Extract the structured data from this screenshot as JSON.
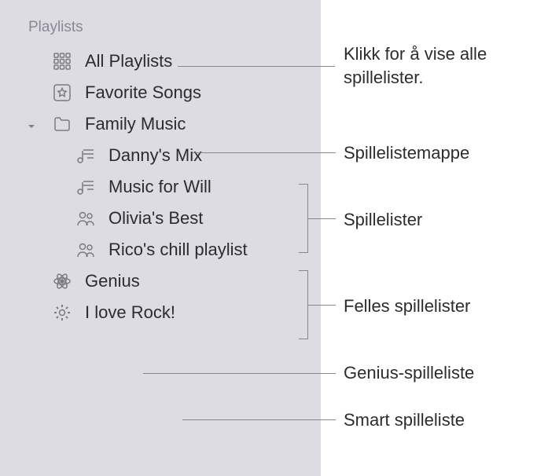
{
  "sidebar": {
    "section_header": "Playlists",
    "items": [
      {
        "label": "All Playlists"
      },
      {
        "label": "Favorite Songs"
      },
      {
        "label": "Family Music"
      },
      {
        "label": "Danny's Mix"
      },
      {
        "label": "Music for Will"
      },
      {
        "label": "Olivia's Best"
      },
      {
        "label": "Rico's chill playlist"
      },
      {
        "label": "Genius"
      },
      {
        "label": "I love Rock!"
      }
    ]
  },
  "annotations": {
    "all_playlists": "Klikk for å vise alle spillelister.",
    "folder": "Spillelistemappe",
    "playlists": "Spillelister",
    "shared": "Felles spillelister",
    "genius": "Genius-spilleliste",
    "smart": "Smart spilleliste"
  }
}
